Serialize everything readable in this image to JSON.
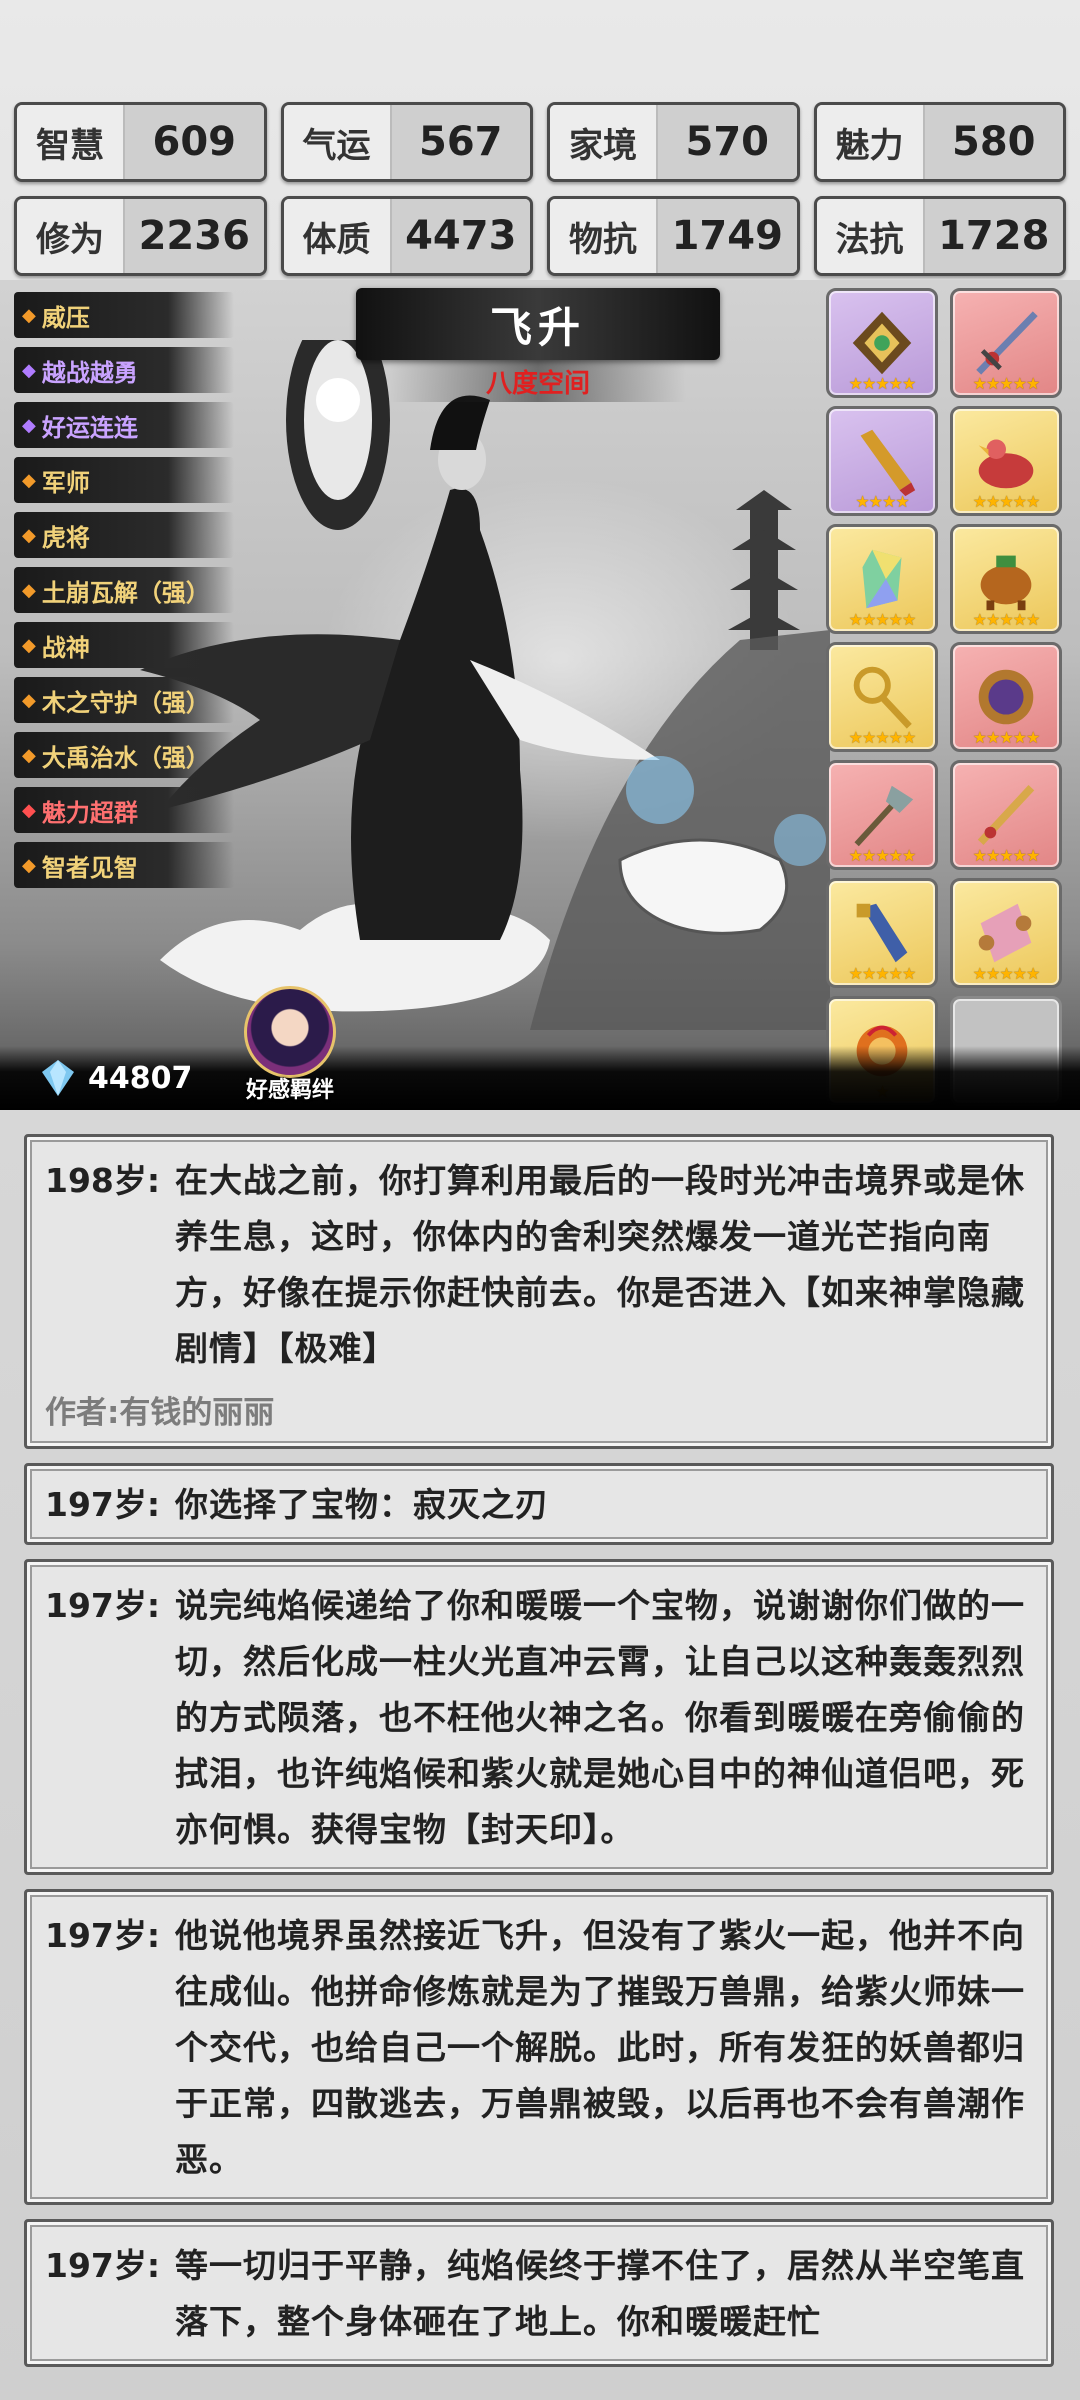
{
  "stats": [
    {
      "label": "智慧",
      "value": "609"
    },
    {
      "label": "气运",
      "value": "567"
    },
    {
      "label": "家境",
      "value": "570"
    },
    {
      "label": "魅力",
      "value": "580"
    },
    {
      "label": "修为",
      "value": "2236"
    },
    {
      "label": "体质",
      "value": "4473"
    },
    {
      "label": "物抗",
      "value": "1749"
    },
    {
      "label": "法抗",
      "value": "1728"
    }
  ],
  "traits": [
    {
      "label": "威压",
      "color": "#f1d27a"
    },
    {
      "label": "越战越勇",
      "color": "#c9a3ff"
    },
    {
      "label": "好运连连",
      "color": "#c9a3ff"
    },
    {
      "label": "军师",
      "color": "#f1d27a"
    },
    {
      "label": "虎将",
      "color": "#f1d27a"
    },
    {
      "label": "土崩瓦解（强）",
      "color": "#f1d27a"
    },
    {
      "label": "战神",
      "color": "#f1d27a"
    },
    {
      "label": "木之守护（强）",
      "color": "#f1d27a"
    },
    {
      "label": "大禹治水（强）",
      "color": "#f1d27a"
    },
    {
      "label": "魅力超群",
      "color": "#ff7070"
    },
    {
      "label": "智者见智",
      "color": "#f1d27a"
    }
  ],
  "realm": {
    "title": "飞升",
    "subtitle": "八度空间"
  },
  "items": [
    {
      "icon": "ornate-amulet-icon",
      "rarity": "purple",
      "stars": "★★★★★"
    },
    {
      "icon": "jeweled-sword-icon",
      "rarity": "red",
      "stars": "★★★★★"
    },
    {
      "icon": "golden-telescope-icon",
      "rarity": "purple",
      "stars": "★★★★"
    },
    {
      "icon": "red-bird-pot-icon",
      "rarity": "gold",
      "stars": "★★★★★"
    },
    {
      "icon": "rainbow-crystal-icon",
      "rarity": "gold",
      "stars": "★★★★★"
    },
    {
      "icon": "bronze-cauldron-icon",
      "rarity": "gold",
      "stars": "★★★★★"
    },
    {
      "icon": "golden-scepter-icon",
      "rarity": "gold",
      "stars": "★★★★★"
    },
    {
      "icon": "mirror-icon",
      "rarity": "red",
      "stars": "★★★★★"
    },
    {
      "icon": "halberd-icon",
      "rarity": "red",
      "stars": "★★★★★"
    },
    {
      "icon": "ornate-blade-icon",
      "rarity": "red",
      "stars": "★★★★★"
    },
    {
      "icon": "blue-dagger-icon",
      "rarity": "gold",
      "stars": "★★★★★"
    },
    {
      "icon": "pink-scroll-icon",
      "rarity": "gold",
      "stars": "★★★★★"
    },
    {
      "icon": "fire-ring-icon",
      "rarity": "gold",
      "stars": "★"
    },
    {
      "icon": "empty-slot",
      "rarity": "empty",
      "stars": ""
    }
  ],
  "currency": {
    "icon": "diamond-icon",
    "amount": "44807"
  },
  "companion": {
    "label": "好感羁绊"
  },
  "log": [
    {
      "age": "198岁:",
      "text": "在大战之前，你打算利用最后的一段时光冲击境界或是休养生息，这时，你体内的舍利突然爆发一道光芒指向南方，好像在提示你赶快前去。你是否进入【如来神掌隐藏剧情】【极难】",
      "author": "作者:有钱的丽丽"
    },
    {
      "age": "197岁:",
      "text": "你选择了宝物：寂灭之刃"
    },
    {
      "age": "197岁:",
      "text": "说完纯焰候递给了你和暖暖一个宝物，说谢谢你们做的一切，然后化成一柱火光直冲云霄，让自己以这种轰轰烈烈的方式陨落，也不枉他火神之名。你看到暖暖在旁偷偷的拭泪，也许纯焰候和紫火就是她心目中的神仙道侣吧，死亦何惧。获得宝物【封天印】。"
    },
    {
      "age": "197岁:",
      "text": "他说他境界虽然接近飞升，但没有了紫火一起，他并不向往成仙。他拼命修炼就是为了摧毁万兽鼎，给紫火师妹一个交代，也给自己一个解脱。此时，所有发狂的妖兽都归于正常，四散逃去，万兽鼎被毁，以后再也不会有兽潮作恶。"
    },
    {
      "age": "197岁:",
      "text": "等一切归于平静，纯焰候终于撑不住了，居然从半空笔直落下，整个身体砸在了地上。你和暖暖赶忙"
    }
  ]
}
